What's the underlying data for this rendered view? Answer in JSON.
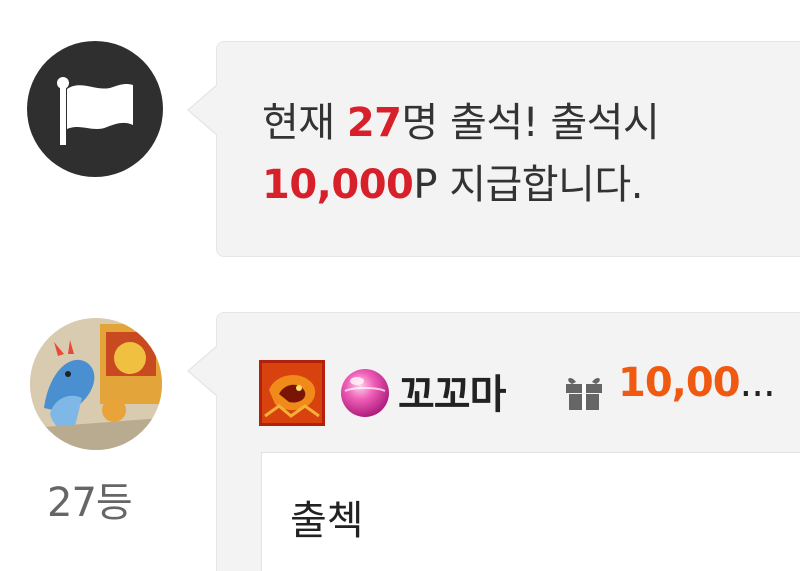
{
  "notice": {
    "line1_prefix": "현재 ",
    "line1_count": "27",
    "line1_suffix": "명 출석! 출석시",
    "line2_amount": "10,000",
    "line2_suffix": "P 지급합니다.",
    "icon": "flag-icon",
    "highlight_color": "#d8202a"
  },
  "comment": {
    "rank": "27등",
    "nickname": "꼬꼬마",
    "points": "10,00",
    "points_ellipsis": "...",
    "text": "출첵",
    "level_icon": "level-badge-icon",
    "grade_icon": "gem-icon",
    "gift_icon": "gift-icon",
    "points_color": "#f05a10"
  }
}
